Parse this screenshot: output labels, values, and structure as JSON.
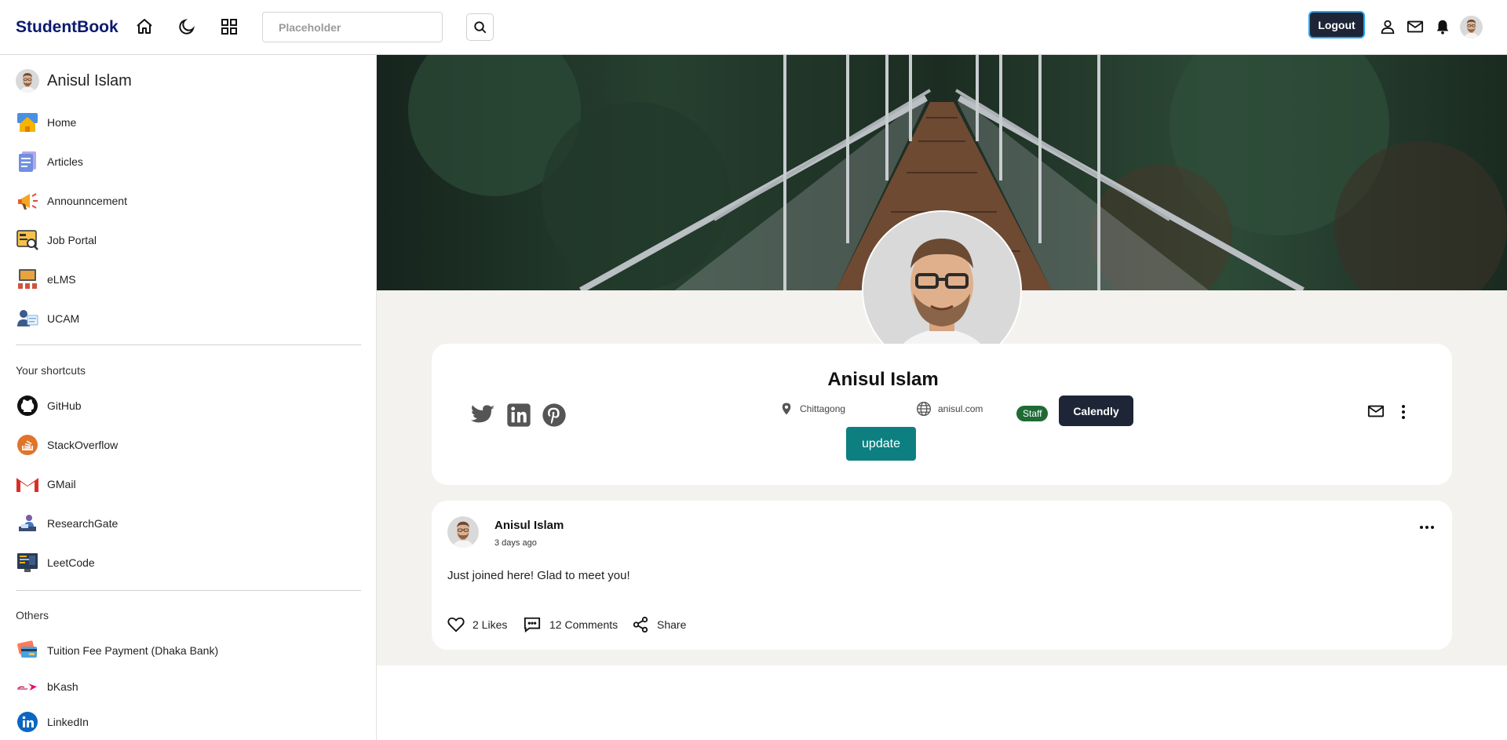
{
  "app": {
    "brand": "StudentBook"
  },
  "header": {
    "search_placeholder": "Placeholder",
    "logout_label": "Logout",
    "icons": [
      "home-icon",
      "moon-icon",
      "apps-grid-icon",
      "search-icon",
      "user-icon",
      "mail-icon",
      "bell-icon",
      "avatar"
    ]
  },
  "sidebar": {
    "user_name": "Anisul Islam",
    "main_items": [
      {
        "label": "Home",
        "icon": "home-icon"
      },
      {
        "label": "Articles",
        "icon": "articles-icon"
      },
      {
        "label": "Announncement",
        "icon": "megaphone-icon"
      },
      {
        "label": "Job Portal",
        "icon": "job-portal-icon"
      },
      {
        "label": "eLMS",
        "icon": "elms-icon"
      },
      {
        "label": "UCAM",
        "icon": "ucam-icon"
      }
    ],
    "shortcuts_title": "Your shortcuts",
    "shortcuts": [
      {
        "label": "GitHub",
        "icon": "github-icon"
      },
      {
        "label": "StackOverflow",
        "icon": "stackoverflow-icon"
      },
      {
        "label": "GMail",
        "icon": "gmail-icon"
      },
      {
        "label": "ResearchGate",
        "icon": "researchgate-icon"
      },
      {
        "label": "LeetCode",
        "icon": "leetcode-icon"
      }
    ],
    "others_title": "Others",
    "others": [
      {
        "label": "Tuition Fee Payment (Dhaka Bank)",
        "icon": "credit-card-icon"
      },
      {
        "label": "bKash",
        "icon": "bkash-icon"
      },
      {
        "label": "LinkedIn",
        "icon": "linkedin-icon"
      }
    ]
  },
  "profile": {
    "name": "Anisul Islam",
    "location": "Chittagong",
    "website": "anisul.com",
    "badge": "Staff",
    "calendly_label": "Calendly",
    "update_label": "update",
    "social": [
      "twitter-icon",
      "linkedin-icon",
      "pinterest-icon"
    ]
  },
  "post": {
    "author": "Anisul Islam",
    "time": "3 days ago",
    "text": "Just joined here! Glad to meet you!",
    "likes": "2 Likes",
    "comments": "12 Comments",
    "share": "Share"
  },
  "colors": {
    "brand": "#0b1a6e",
    "dark_button": "#1d2536",
    "teal_button": "#0d7f80",
    "staff_badge": "#1e6b35",
    "main_bg": "#f3f2ef"
  }
}
